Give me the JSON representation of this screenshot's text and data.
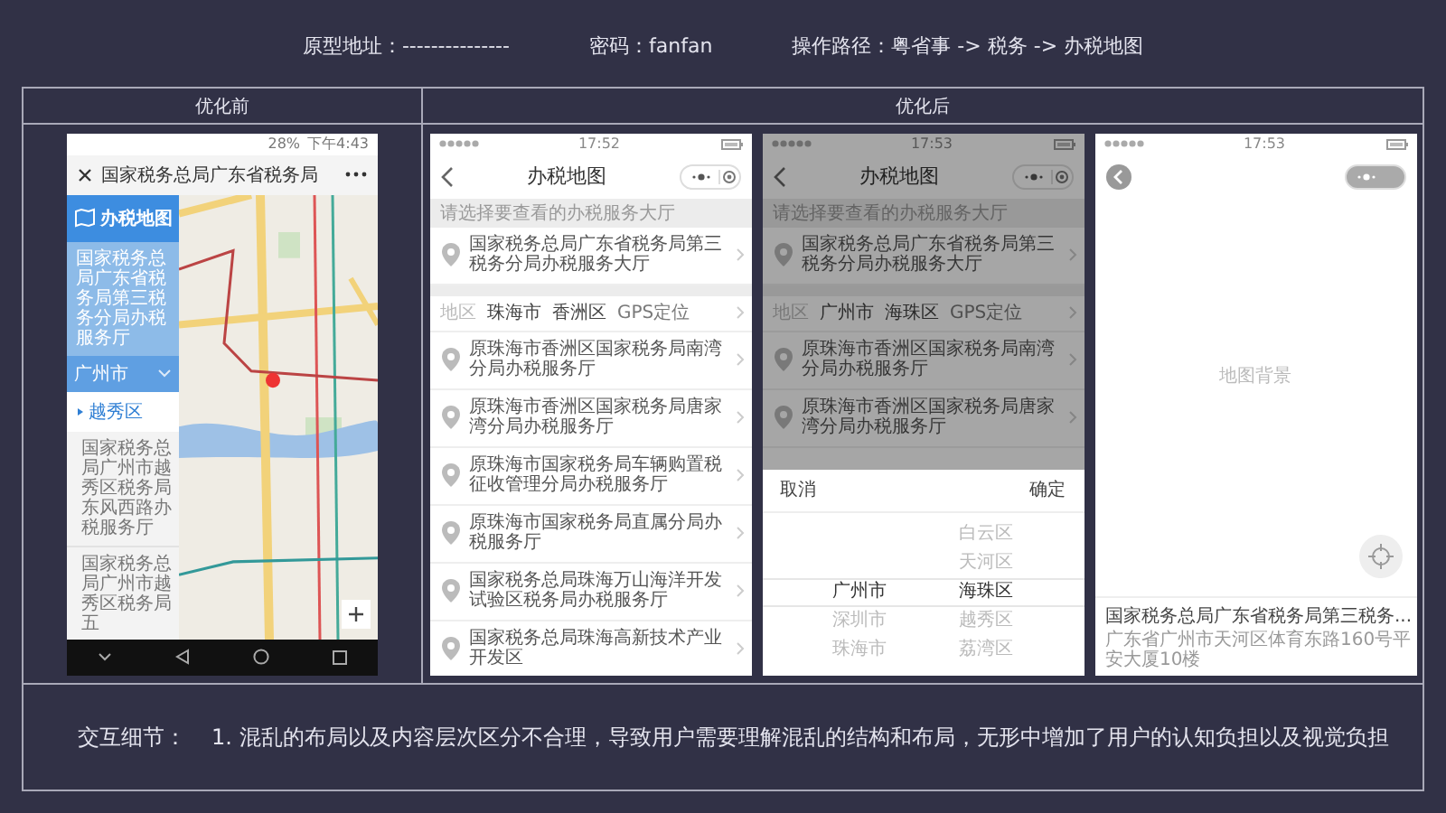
{
  "header": [
    "原型地址：---------------",
    "密码：fanfan",
    "操作路径：粤省事 -> 税务 -> 办税地图"
  ],
  "columns": [
    "优化前",
    "优化后"
  ],
  "before": {
    "status": {
      "battery": "28%",
      "time": "下午4:43"
    },
    "title": "国家税务总局广东省税务局",
    "sidebar": {
      "heading": "办税地图",
      "current_hall": "国家税务总局广东省税务局第三税务分局办税服务厅",
      "city": "广州市",
      "district": "越秀区",
      "halls": [
        "国家税务总局广州市越秀区税务局东风西路办税服务厅",
        "国家税务总局广州市越秀区税务局五"
      ]
    }
  },
  "after": [
    {
      "kind": "list",
      "time": "17:52",
      "title": "办税地图",
      "hint": "请选择要查看的办税服务大厅",
      "current_hall": "国家税务总局广东省税务局第三税务分局办税服务大厅",
      "region_label": "地区",
      "city": "珠海市",
      "district": "香洲区",
      "gps": "GPS定位",
      "halls": [
        "原珠海市香洲区国家税务局南湾分局办税服务厅",
        "原珠海市香洲区国家税务局唐家湾分局办税服务厅",
        "原珠海市国家税务局车辆购置税征收管理分局办税服务厅",
        "原珠海市国家税务局直属分局办税服务厅",
        "国家税务总局珠海万山海洋开发试验区税务局办税服务厅",
        "国家税务总局珠海高新技术产业开发区"
      ]
    },
    {
      "kind": "list",
      "time": "17:53",
      "title": "办税地图",
      "hint": "请选择要查看的办税服务大厅",
      "current_hall": "国家税务总局广东省税务局第三税务分局办税服务大厅",
      "region_label": "地区",
      "city": "广州市",
      "district": "海珠区",
      "gps": "GPS定位",
      "halls": [
        "原珠海市香洲区国家税务局南湾分局办税服务厅",
        "原珠海市香洲区国家税务局唐家湾分局办税服务厅"
      ],
      "picker": {
        "cancel": "取消",
        "confirm": "确定",
        "cities": [
          {
            "label": "广州市",
            "selected": true
          },
          {
            "label": "深圳市",
            "selected": false
          },
          {
            "label": "珠海市",
            "selected": false
          }
        ],
        "districts": [
          {
            "label": "白云区",
            "selected": false
          },
          {
            "label": "天河区",
            "selected": false
          },
          {
            "label": "海珠区",
            "selected": true
          },
          {
            "label": "越秀区",
            "selected": false
          },
          {
            "label": "荔湾区",
            "selected": false
          }
        ]
      }
    },
    {
      "kind": "map",
      "time": "17:53",
      "map_label": "地图背景",
      "hall_name": "国家税务总局广东省税务局第三税务...",
      "address": "广东省广州市天河区体育东路160号平安大厦10楼"
    }
  ],
  "notes": {
    "label": "交互细节：",
    "items": [
      "1. 混乱的布局以及内容层次区分不合理，导致用户需要理解混乱的结构和布局，无形中增加了用户的认知负担以及视觉负担"
    ]
  }
}
